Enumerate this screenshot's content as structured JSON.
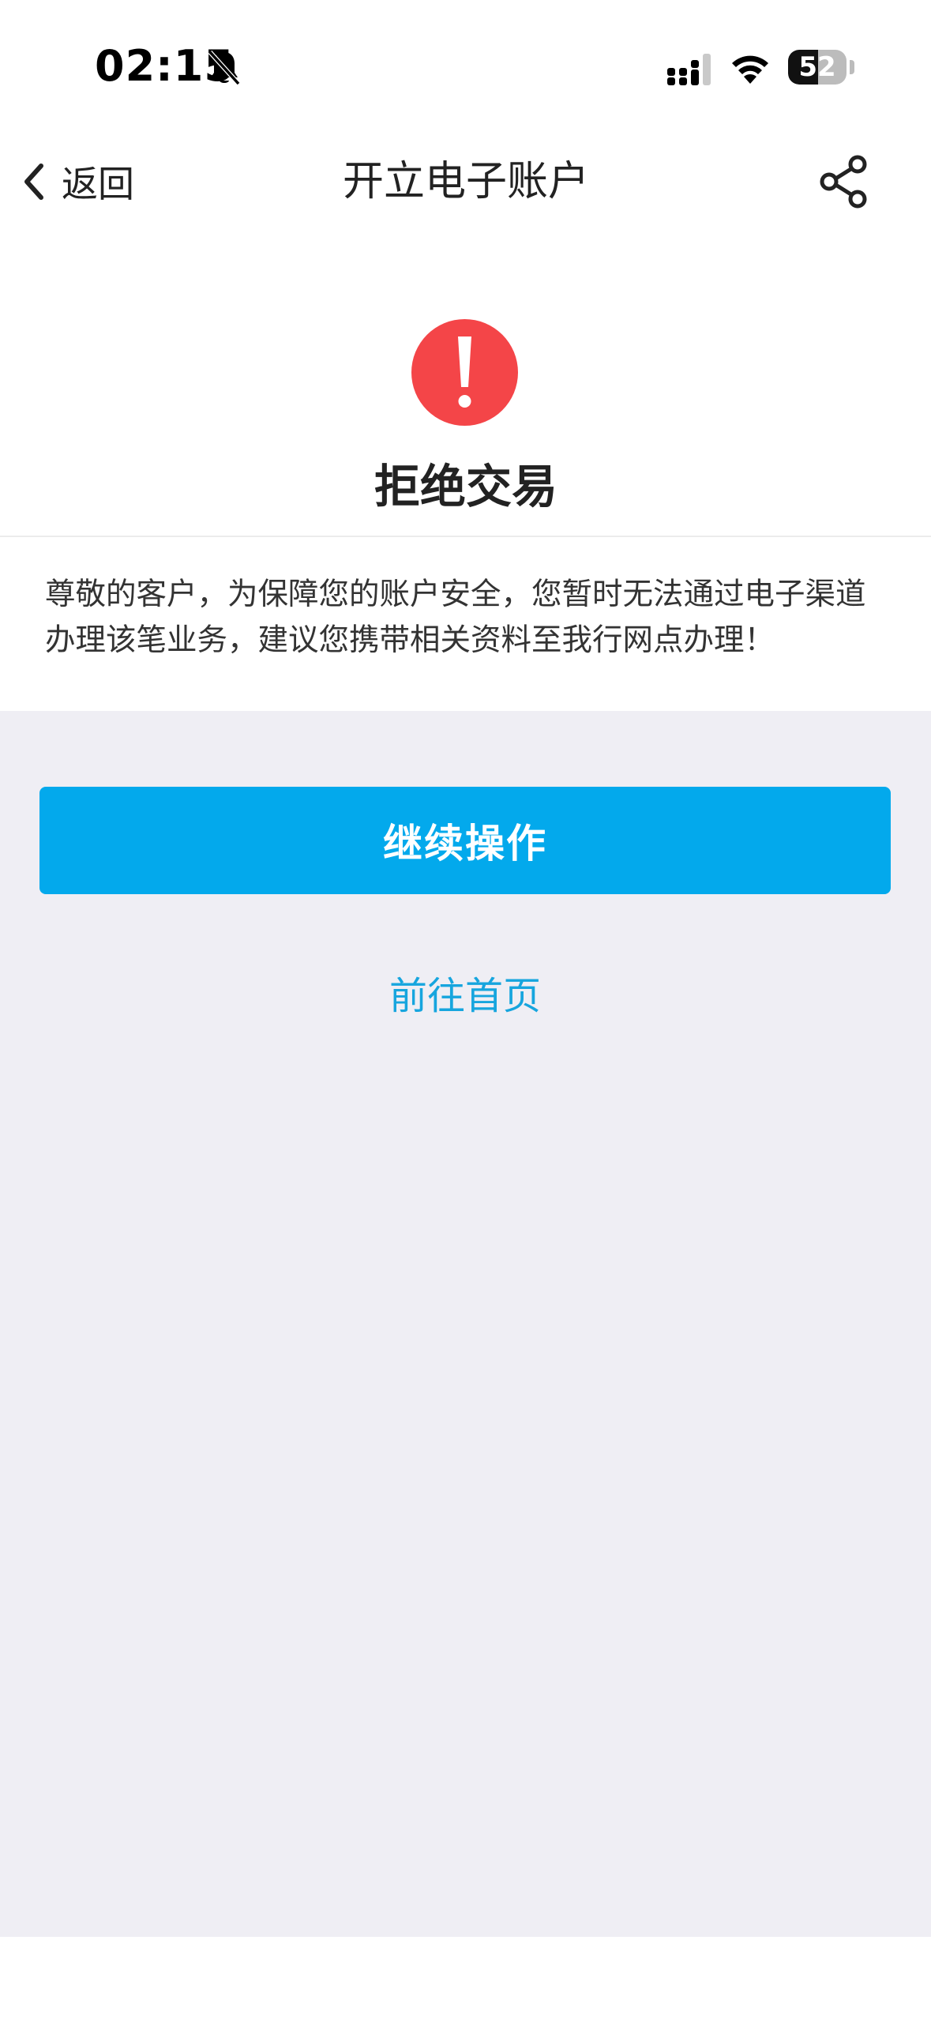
{
  "status_bar": {
    "time": "02:15",
    "battery_level": "52",
    "battery_fraction": 0.52,
    "icons": [
      "bell-slash-icon",
      "signal-icon",
      "wifi-icon",
      "battery-icon"
    ]
  },
  "nav": {
    "back_label": "返回",
    "title": "开立电子账户",
    "back_icon": "chevron-left-icon",
    "share_icon": "share-icon"
  },
  "result": {
    "icon": "exclamation-circle-icon",
    "title": "拒绝交易",
    "message": "尊敬的客户，为保障您的账户安全，您暂时无法通过电子渠道办理该笔业务，建议您携带相关资料至我行网点办理！"
  },
  "actions": {
    "primary_label": "继续操作",
    "link_label": "前往首页"
  },
  "colors": {
    "primary": "#03a9ec",
    "link": "#16a5de",
    "alert": "#f44548",
    "panel_bg": "#efeef4"
  }
}
